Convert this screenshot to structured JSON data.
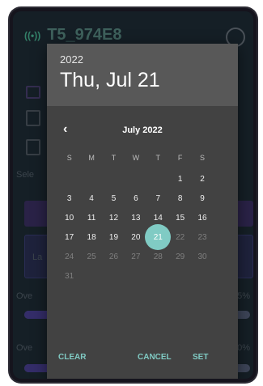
{
  "background": {
    "device_title": "T5_974E8",
    "partial_labels": [
      "Sele",
      "La",
      "Ove",
      "5%",
      "Ove",
      "00%"
    ]
  },
  "dialog": {
    "year": "2022",
    "date_title": "Thu, Jul 21",
    "month_label": "July 2022",
    "weekdays": [
      "S",
      "M",
      "T",
      "W",
      "T",
      "F",
      "S"
    ],
    "weeks": [
      [
        "",
        "",
        "",
        "",
        "",
        "1",
        "2"
      ],
      [
        "3",
        "4",
        "5",
        "6",
        "7",
        "8",
        "9"
      ],
      [
        "10",
        "11",
        "12",
        "13",
        "14",
        "15",
        "16"
      ],
      [
        "17",
        "18",
        "19",
        "20",
        "21",
        "22",
        "23"
      ],
      [
        "24",
        "25",
        "26",
        "27",
        "28",
        "29",
        "30"
      ],
      [
        "31",
        "",
        "",
        "",
        "",
        "",
        ""
      ]
    ],
    "selected_day": "21",
    "buttons": {
      "clear": "CLEAR",
      "cancel": "CANCEL",
      "set": "SET"
    }
  },
  "colors": {
    "accent": "#80cbc4",
    "dialog_bg": "#424242",
    "header_bg": "#585858"
  }
}
